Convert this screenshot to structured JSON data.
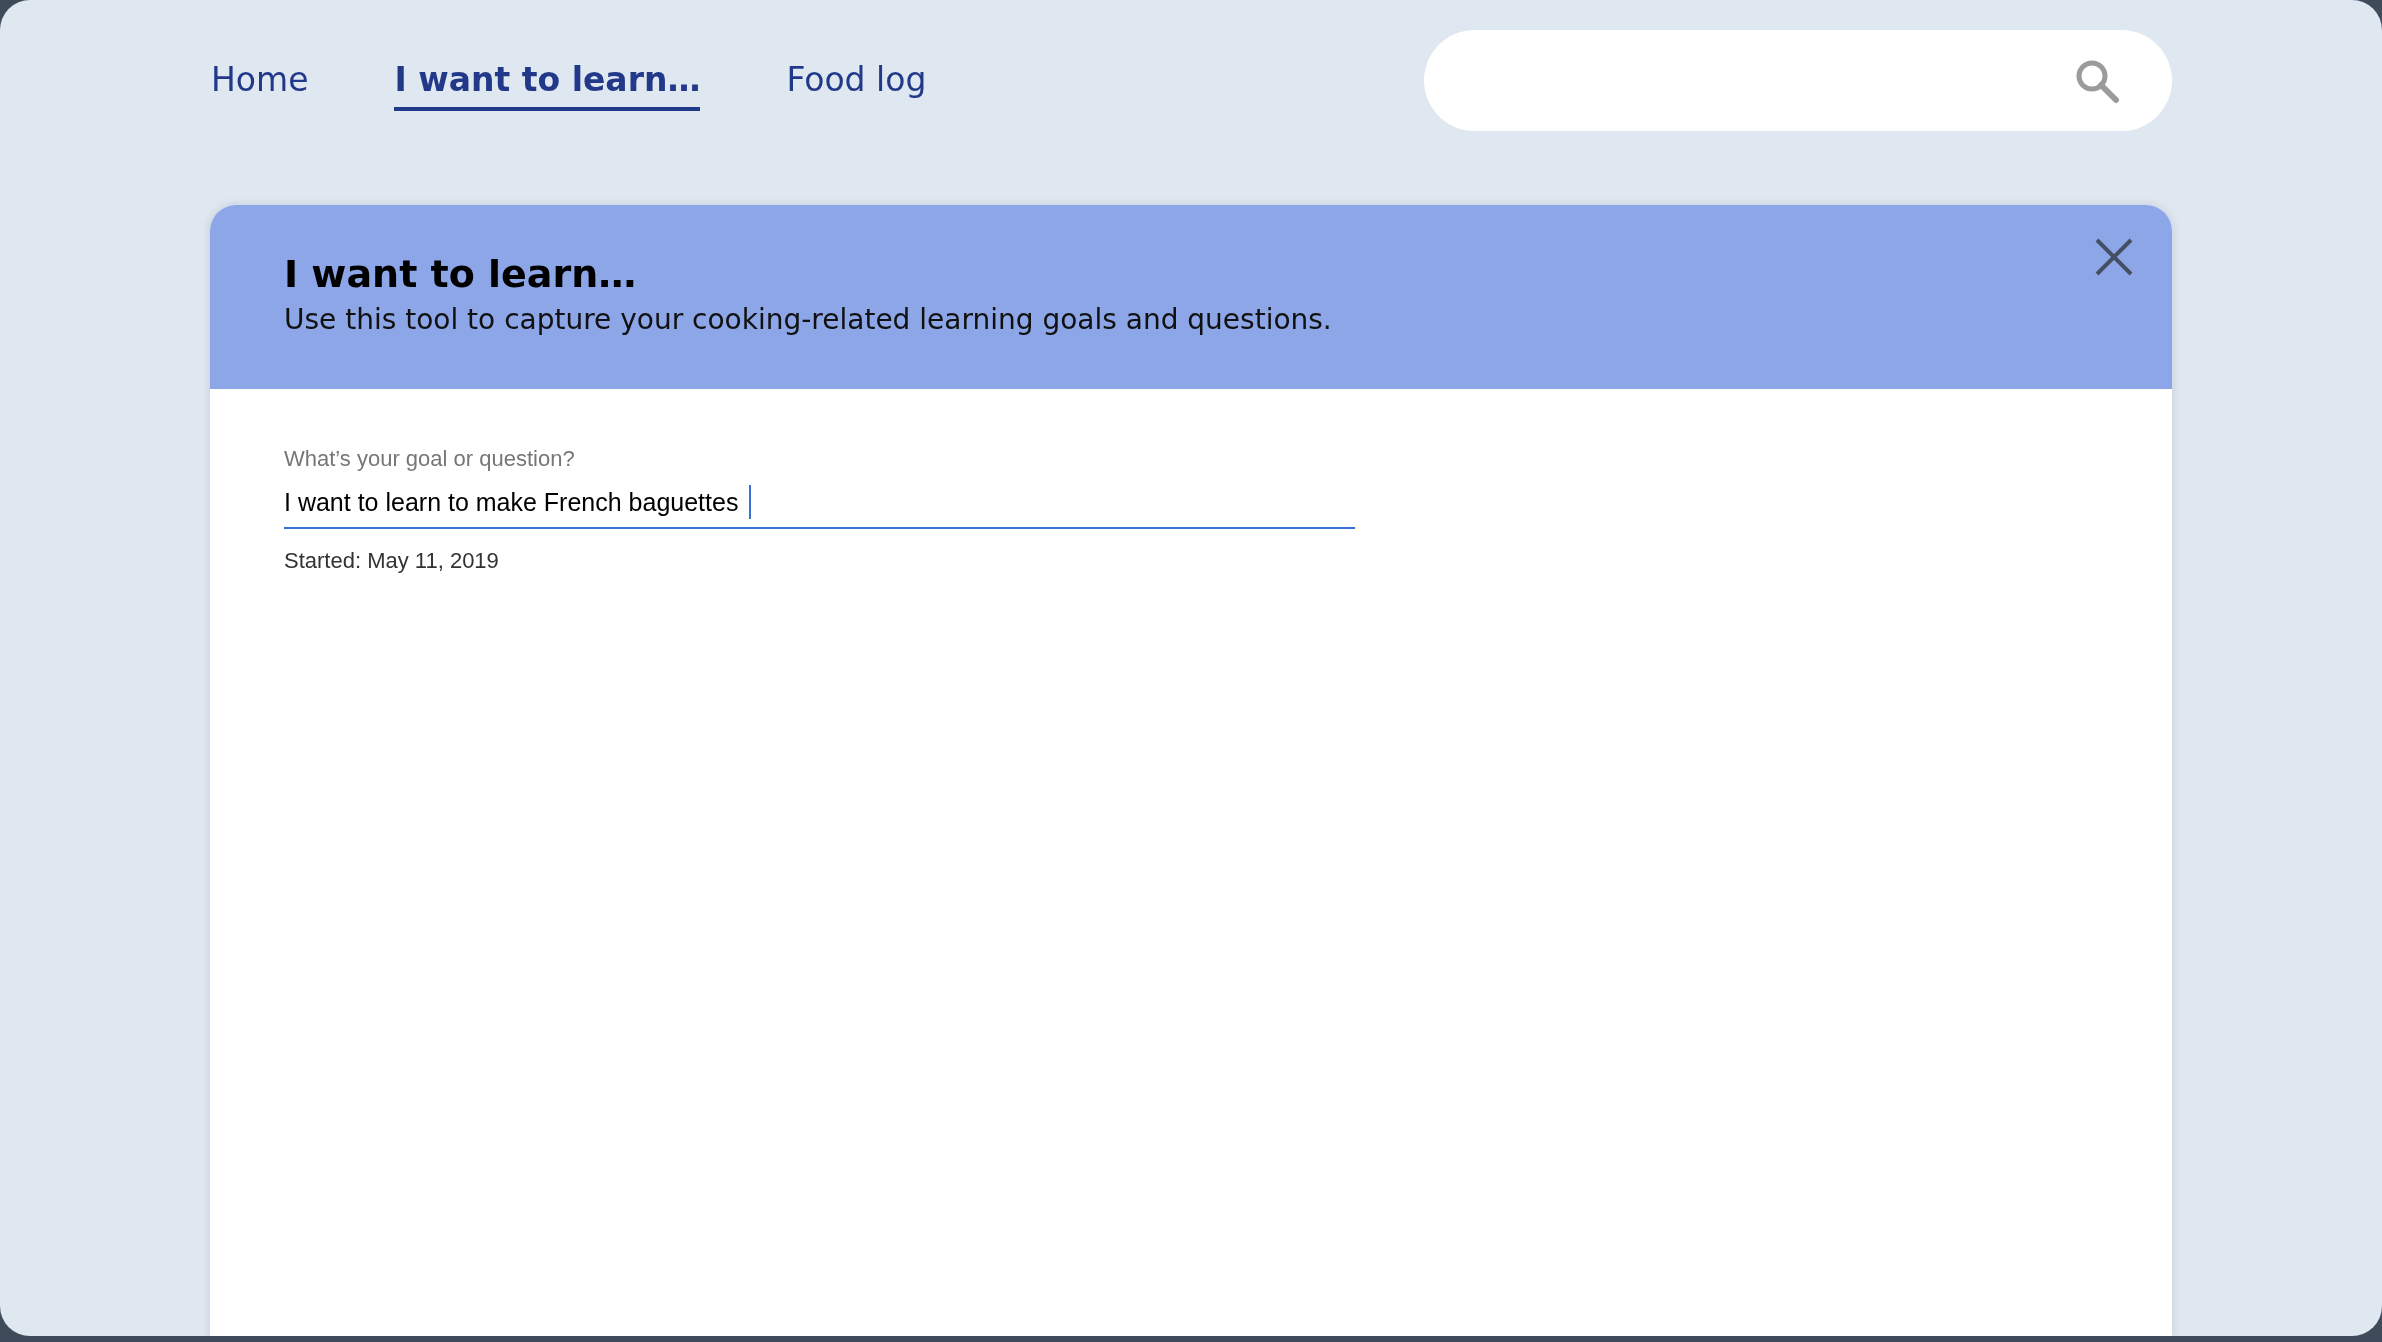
{
  "nav": {
    "tabs": [
      {
        "label": "Home",
        "selected": false
      },
      {
        "label": "I want to learn…",
        "selected": true
      },
      {
        "label": "Food log",
        "selected": false
      }
    ]
  },
  "panel": {
    "title": "I want to learn…",
    "subtitle": "Use this tool to capture your cooking-related learning goals and questions.",
    "goal_field": {
      "label": "What’s your goal or question?",
      "value": "I want to learn to make French baguettes",
      "focused": true
    },
    "started": "Started: May 11, 2019"
  }
}
